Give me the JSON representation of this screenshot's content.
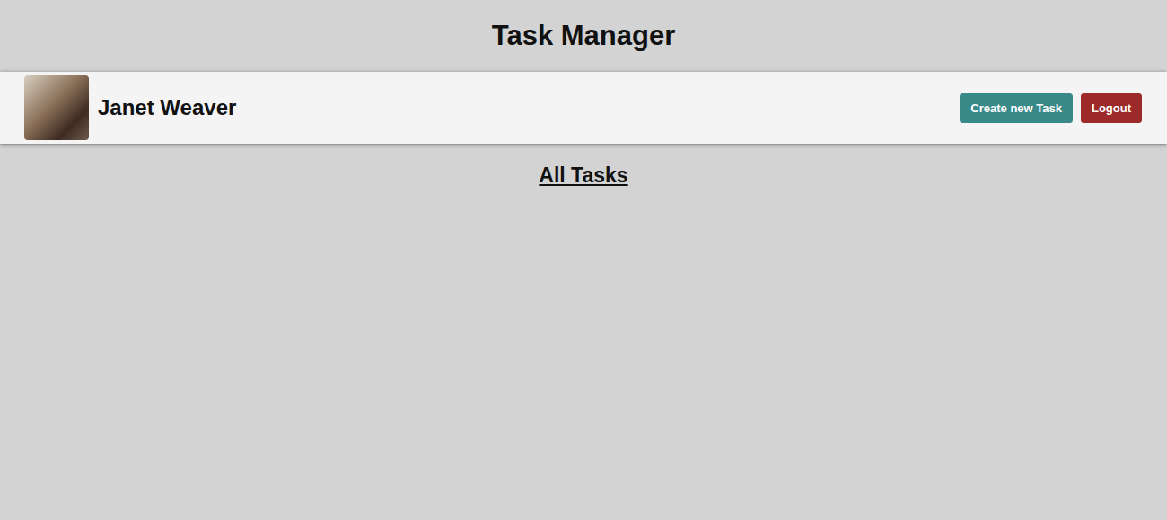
{
  "header": {
    "title": "Task Manager"
  },
  "user_bar": {
    "name": "Janet Weaver",
    "buttons": [
      {
        "label": "Create new Task",
        "color": "#3b8a8a"
      },
      {
        "label": "Logout",
        "color": "#9c2a2a"
      }
    ]
  },
  "section": {
    "title": "All Tasks"
  }
}
